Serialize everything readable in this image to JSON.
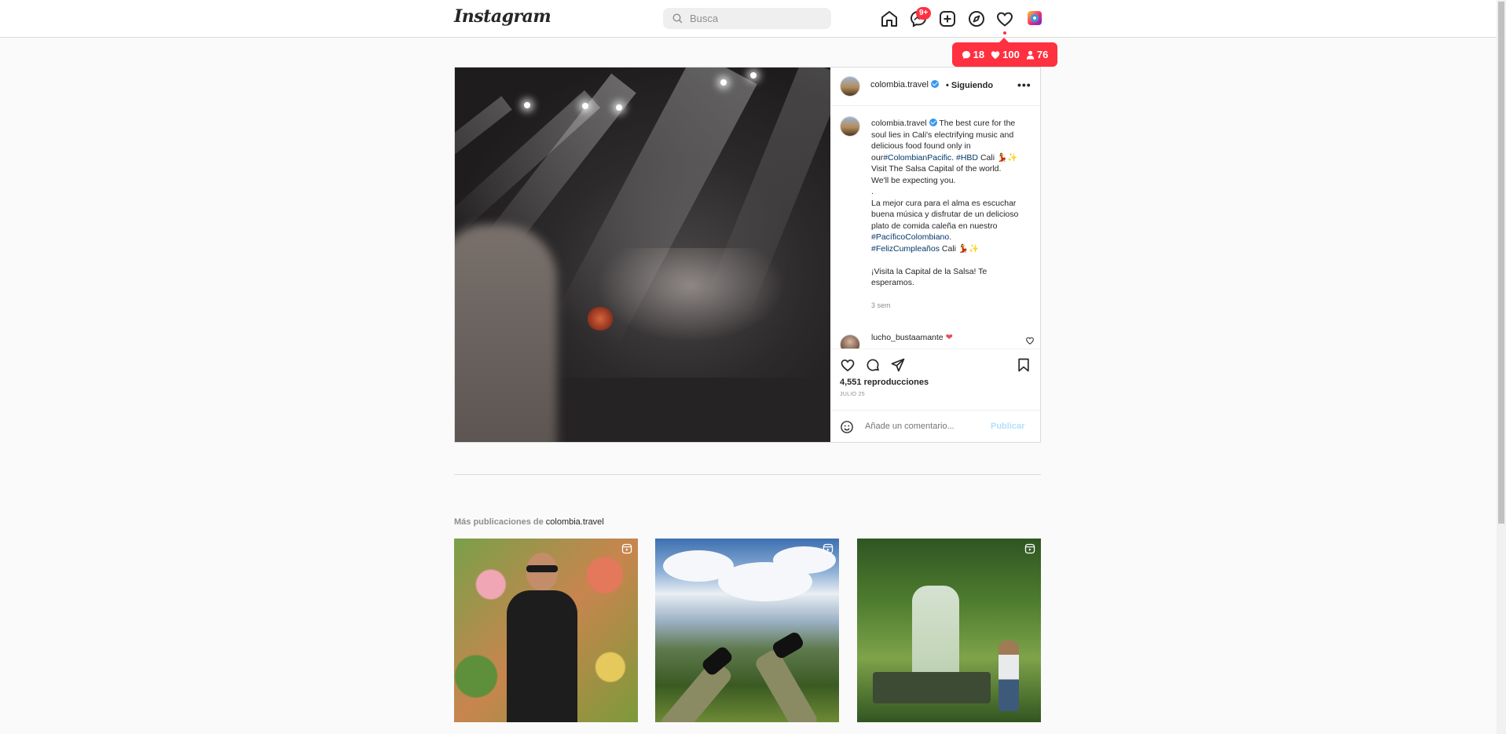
{
  "nav": {
    "logo": "Instagram",
    "search_placeholder": "Busca",
    "messages_badge": "9+",
    "activity": {
      "comments": "18",
      "likes": "100",
      "followers": "76"
    }
  },
  "post": {
    "author": "colombia.travel",
    "follow_status": "• Siguiendo",
    "caption_user": "colombia.travel",
    "caption_part1": "The best cure for the soul lies in Cali's electrifying music and delicious food found only in our",
    "tag1": "#ColombianPacific",
    "tag2": "#HBD",
    "caption_part2": "Cali 💃✨\nVisit The Salsa Capital of the world. We'll be expecting you.\n.\nLa mejor cura para el alma es escuchar buena música y disfrutar de un delicioso plato de comida caleña en nuestro",
    "tag3": "#PacíficoColombiano",
    "tag4": "#FelizCumpleaños",
    "caption_part3": "Cali 💃✨\n\n¡Visita la Capital de la Salsa! Te esperamos.",
    "time_ago": "3 sem",
    "comment_user": "lucho_bustaamante",
    "comment_emoji": "❤",
    "views": "4,551 reproducciones",
    "date": "JULIO 25",
    "comment_placeholder": "Añade un comentario...",
    "publish_label": "Publicar"
  },
  "more": {
    "title_prefix": "Más publicaciones de",
    "account": "colombia.travel"
  },
  "colors": {
    "accent": "#ff3040",
    "link": "#00376b",
    "verified": "#3897f0",
    "publish_disabled": "#b2dffc"
  }
}
